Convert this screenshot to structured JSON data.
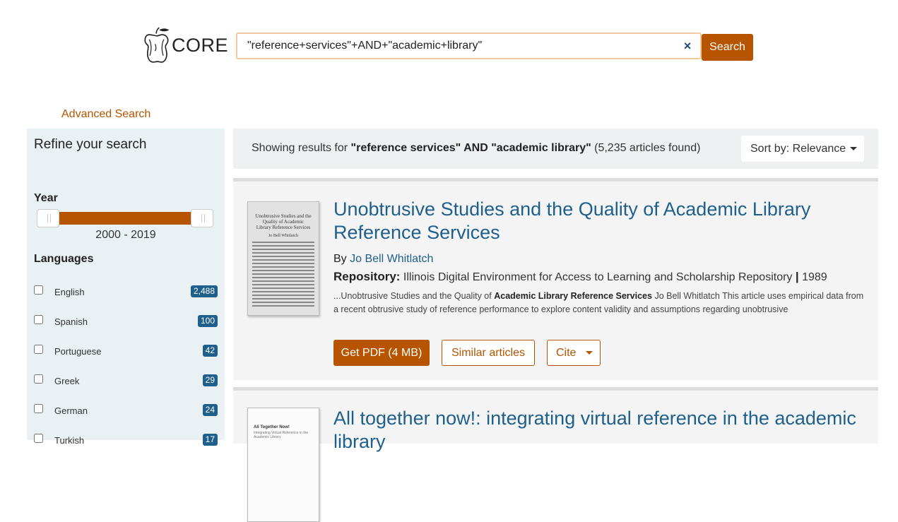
{
  "header": {
    "logo_text": "CORE",
    "search_value": "\"reference+services\"+AND+\"academic+library\"",
    "clear_label": "×",
    "search_button": "Search",
    "advanced_search": "Advanced Search"
  },
  "sidebar": {
    "title": "Refine your search",
    "year_label": "Year",
    "year_range": "2000 - 2019",
    "languages_label": "Languages",
    "languages": [
      {
        "name": "English",
        "count": "2,488"
      },
      {
        "name": "Spanish",
        "count": "100"
      },
      {
        "name": "Portuguese",
        "count": "42"
      },
      {
        "name": "Greek",
        "count": "29"
      },
      {
        "name": "German",
        "count": "24"
      },
      {
        "name": "Turkish",
        "count": "17"
      }
    ]
  },
  "results": {
    "prefix": "Showing results for ",
    "query": "\"reference services\" AND \"academic library\"",
    "suffix": " (5,235 articles found)",
    "sort_label": "Sort by: Relevance"
  },
  "items": [
    {
      "title": "Unobtrusive Studies and the Quality of Academic Library Reference Services",
      "by_label": "By ",
      "author": "Jo Bell Whitlatch",
      "repo_label": "Repository:",
      "repo": " Illinois Digital Environment for Access to Learning and Scholarship Repository ",
      "sep": "|",
      "year": " 1989",
      "snippet_pre": "...Unobtrusive Studies and the Quality of ",
      "snippet_bold": "Academic Library Reference Services",
      "snippet_post": " Jo Bell Whitlatch This article uses empirical data from a recent obtrusive study of reference performance to explore content validity and assumptions regarding unobtrusive",
      "thumb_title": "Unobtrusive Studies and the Quality of Academic Library Reference Services",
      "thumb_author": "Jo Bell Whitlatch",
      "pdf_button": "Get PDF (4 MB)",
      "similar_button": "Similar articles",
      "cite_button": "Cite"
    },
    {
      "title": "All together now!: integrating virtual reference in the academic library",
      "thumb_title": "All Together Now!",
      "thumb_subtitle": "Integrating Virtual Reference in the Academic Library"
    }
  ],
  "colors": {
    "accent": "#b75400",
    "link": "#1f5f8b",
    "sidebar_bg": "#e9f1f5"
  }
}
